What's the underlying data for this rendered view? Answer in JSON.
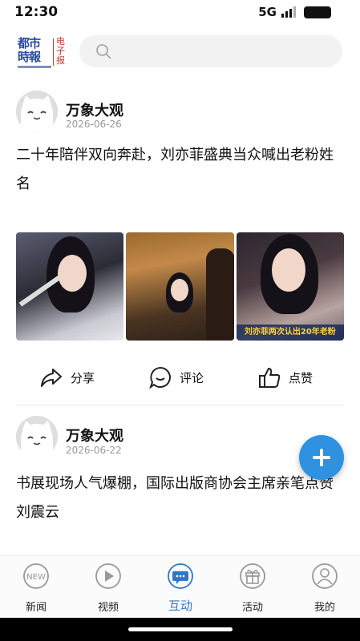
{
  "status_bar": {
    "time": "12:30",
    "network": "5G"
  },
  "header": {
    "logo_text": "都市時報",
    "logo_epaper": "电子报",
    "search": {
      "icon": "search-icon",
      "placeholder": ""
    }
  },
  "posts": [
    {
      "author": "万象大观",
      "date": "2026-06-26",
      "title": "二十年陪伴双向奔赴，刘亦菲盛典当众喊出老粉姓名",
      "image_caption": "刘亦菲两次认出20年老粉",
      "actions": {
        "share": "分享",
        "comment": "评论",
        "like": "点赞"
      }
    },
    {
      "author": "万象大观",
      "date": "2026-06-22",
      "title": "书展现场人气爆棚，国际出版商协会主席亲笔点赞刘震云"
    }
  ],
  "fab": {
    "icon": "plus-icon"
  },
  "bottom_nav": {
    "items": [
      {
        "label": "新闻",
        "icon": "new-badge-icon",
        "active": false
      },
      {
        "label": "视频",
        "icon": "play-icon",
        "active": false
      },
      {
        "label": "互动",
        "icon": "chat-icon",
        "active": true
      },
      {
        "label": "活动",
        "icon": "gift-icon",
        "active": false
      },
      {
        "label": "我的",
        "icon": "user-icon",
        "active": false
      }
    ]
  },
  "colors": {
    "accent": "#2f78c8",
    "fab": "#2f92e0"
  }
}
